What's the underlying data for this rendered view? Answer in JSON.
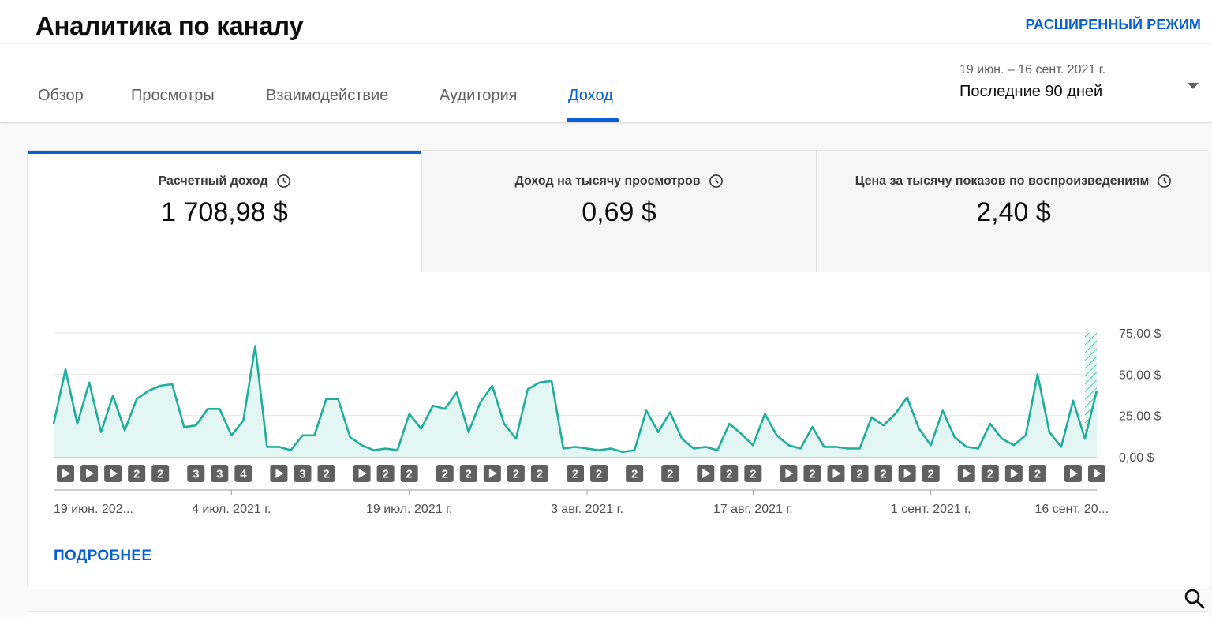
{
  "header": {
    "title": "Аналитика по каналу",
    "advanced_mode": "РАСШИРЕННЫЙ РЕЖИМ",
    "tabs": [
      {
        "label": "Обзор",
        "active": false
      },
      {
        "label": "Просмотры",
        "active": false
      },
      {
        "label": "Взаимодействие",
        "active": false
      },
      {
        "label": "Аудитория",
        "active": false
      },
      {
        "label": "Доход",
        "active": true
      }
    ],
    "date_range": "19 июн. – 16 сент. 2021 г.",
    "date_preset": "Последние 90 дней",
    "dropdown_icon": "triangle-down-icon"
  },
  "metrics": [
    {
      "label": "Расчетный доход",
      "value": "1 708,98 $",
      "selected": true
    },
    {
      "label": "Доход на тысячу просмотров",
      "value": "0,69 $",
      "selected": false
    },
    {
      "label": "Цена за тысячу показов по воспроизведениям",
      "value": "2,40 $",
      "selected": false
    }
  ],
  "more_link": "ПОДРОБНЕЕ",
  "accent_color": "#065fd4",
  "line_color": "#1fae9c",
  "chart_data": {
    "type": "area",
    "series": [
      {
        "values": [
          20,
          53,
          20,
          45,
          15,
          37,
          16,
          35,
          40,
          43,
          44,
          18,
          19,
          29,
          29,
          13,
          22,
          67,
          6,
          6,
          4,
          13,
          13,
          35,
          35,
          12,
          7,
          4,
          5,
          4,
          26,
          17,
          31,
          29,
          39,
          15,
          33,
          43,
          20,
          11,
          41,
          45,
          46,
          5,
          6,
          5,
          4,
          5,
          3,
          4,
          28,
          15,
          27,
          11,
          5,
          6,
          4,
          20,
          14,
          7,
          26,
          13,
          7,
          5,
          18,
          6,
          6,
          5,
          5,
          24,
          19,
          26,
          36,
          17,
          7,
          28,
          12,
          6,
          5,
          20,
          11,
          7,
          13,
          50,
          15,
          6,
          34,
          11,
          40
        ]
      }
    ],
    "y_ticks": [
      "75,00 $",
      "50,00 $",
      "25,00 $",
      "0,00 $"
    ],
    "ylim": [
      0,
      75
    ],
    "x_ticks": [
      {
        "label": "19 июн. 202...",
        "index": 0
      },
      {
        "label": "4 июл. 2021 г.",
        "index": 15
      },
      {
        "label": "19 июл. 2021 г.",
        "index": 30
      },
      {
        "label": "3 авг. 2021 г.",
        "index": 45
      },
      {
        "label": "17 авг. 2021 г.",
        "index": 59
      },
      {
        "label": "1 сент. 2021 г.",
        "index": 74
      },
      {
        "label": "16 сент. 20...",
        "index": 89
      }
    ],
    "markers": [
      {
        "index": 1,
        "kind": "play"
      },
      {
        "index": 3,
        "kind": "play"
      },
      {
        "index": 5,
        "kind": "play"
      },
      {
        "index": 7,
        "kind": "count",
        "value": "2"
      },
      {
        "index": 9,
        "kind": "count",
        "value": "2"
      },
      {
        "index": 12,
        "kind": "count",
        "value": "3"
      },
      {
        "index": 14,
        "kind": "count",
        "value": "3"
      },
      {
        "index": 16,
        "kind": "count",
        "value": "4"
      },
      {
        "index": 19,
        "kind": "play"
      },
      {
        "index": 21,
        "kind": "count",
        "value": "3"
      },
      {
        "index": 23,
        "kind": "count",
        "value": "2"
      },
      {
        "index": 26,
        "kind": "play"
      },
      {
        "index": 28,
        "kind": "count",
        "value": "2"
      },
      {
        "index": 30,
        "kind": "count",
        "value": "2"
      },
      {
        "index": 33,
        "kind": "count",
        "value": "2"
      },
      {
        "index": 35,
        "kind": "count",
        "value": "2"
      },
      {
        "index": 37,
        "kind": "play"
      },
      {
        "index": 39,
        "kind": "count",
        "value": "2"
      },
      {
        "index": 41,
        "kind": "count",
        "value": "2"
      },
      {
        "index": 44,
        "kind": "count",
        "value": "2"
      },
      {
        "index": 46,
        "kind": "count",
        "value": "2"
      },
      {
        "index": 49,
        "kind": "count",
        "value": "2"
      },
      {
        "index": 52,
        "kind": "count",
        "value": "2"
      },
      {
        "index": 55,
        "kind": "play"
      },
      {
        "index": 57,
        "kind": "count",
        "value": "2"
      },
      {
        "index": 59,
        "kind": "count",
        "value": "2"
      },
      {
        "index": 62,
        "kind": "play"
      },
      {
        "index": 64,
        "kind": "count",
        "value": "2"
      },
      {
        "index": 66,
        "kind": "play"
      },
      {
        "index": 68,
        "kind": "count",
        "value": "2"
      },
      {
        "index": 70,
        "kind": "count",
        "value": "2"
      },
      {
        "index": 72,
        "kind": "play"
      },
      {
        "index": 74,
        "kind": "count",
        "value": "2"
      },
      {
        "index": 77,
        "kind": "play"
      },
      {
        "index": 79,
        "kind": "count",
        "value": "2"
      },
      {
        "index": 81,
        "kind": "play"
      },
      {
        "index": 83,
        "kind": "count",
        "value": "2"
      },
      {
        "index": 86,
        "kind": "play"
      },
      {
        "index": 88,
        "kind": "play"
      }
    ]
  }
}
